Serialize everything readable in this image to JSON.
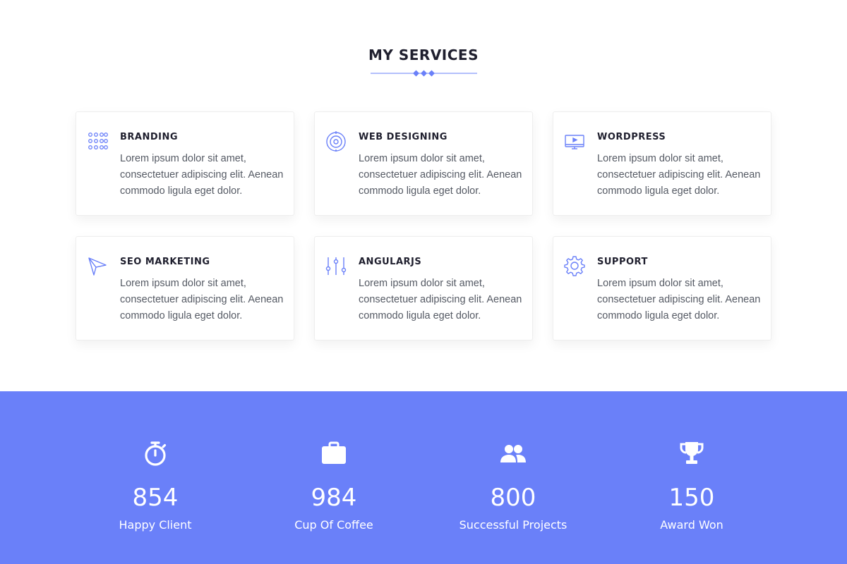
{
  "services": {
    "title": "MY SERVICES",
    "accent_color": "#6a80f9",
    "items": [
      {
        "icon": "grid-dots-icon",
        "title": "BRANDING",
        "text": "Lorem ipsum dolor sit amet, consectetuer adipiscing elit. Aenean commodo ligula eget dolor."
      },
      {
        "icon": "target-icon",
        "title": "WEB DESIGNING",
        "text": "Lorem ipsum dolor sit amet, consectetuer adipiscing elit. Aenean commodo ligula eget dolor."
      },
      {
        "icon": "monitor-play-icon",
        "title": "WORDPRESS",
        "text": "Lorem ipsum dolor sit amet, consectetuer adipiscing elit. Aenean commodo ligula eget dolor."
      },
      {
        "icon": "paper-plane-icon",
        "title": "SEO MARKETING",
        "text": "Lorem ipsum dolor sit amet, consectetuer adipiscing elit. Aenean commodo ligula eget dolor."
      },
      {
        "icon": "sliders-icon",
        "title": "ANGULARJS",
        "text": "Lorem ipsum dolor sit amet, consectetuer adipiscing elit. Aenean commodo ligula eget dolor."
      },
      {
        "icon": "gear-icon",
        "title": "SUPPORT",
        "text": "Lorem ipsum dolor sit amet, consectetuer adipiscing elit. Aenean commodo ligula eget dolor."
      }
    ]
  },
  "stats": {
    "background_color": "#6a80f9",
    "items": [
      {
        "icon": "stopwatch-icon",
        "number": "854",
        "label": "Happy Client"
      },
      {
        "icon": "briefcase-icon",
        "number": "984",
        "label": "Cup Of Coffee"
      },
      {
        "icon": "users-icon",
        "number": "800",
        "label": "Successful Projects"
      },
      {
        "icon": "trophy-icon",
        "number": "150",
        "label": "Award Won"
      }
    ]
  }
}
